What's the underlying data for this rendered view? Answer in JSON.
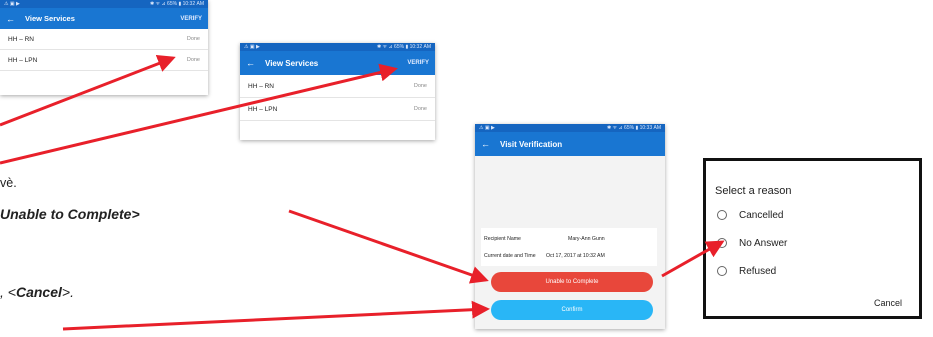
{
  "screen1": {
    "status_left": "⚠ ▣ ▶",
    "status_right": "✱ ᯤ ⊿ 65% ▮ 10:32 AM",
    "title": "View Services",
    "action": "VERIFY",
    "services": [
      {
        "name": "HH – RN",
        "status": "Done"
      },
      {
        "name": "HH – LPN",
        "status": "Done"
      }
    ]
  },
  "screen2": {
    "status_left": "⚠ ▣ ▶",
    "status_right": "✱ ᯤ ⊿ 65% ▮ 10:32 AM",
    "title": "View Services",
    "action": "VERIFY",
    "services": [
      {
        "name": "HH – RN",
        "status": "Done"
      },
      {
        "name": "HH – LPN",
        "status": "Done"
      }
    ]
  },
  "screen3": {
    "status_left": "⚠ ▣ ▶",
    "status_right": "✱ ᯤ ⊿ 65% ▮ 10:33 AM",
    "title": "Visit Verification",
    "recipient_label": "Recipient Name",
    "recipient_value": "Mary-Ann Gunn",
    "date_label": "Current date and Time",
    "date_value": "Oct 17, 2017 at 10:32 AM",
    "unable_button": "Unable to Complete",
    "confirm_button": "Confirm"
  },
  "dialog": {
    "title": "Select a reason",
    "options": [
      "Cancelled",
      "No Answer",
      "Refused"
    ],
    "cancel": "Cancel"
  },
  "doc": {
    "line1": "vè.",
    "line2": "Unable to Complete>",
    "line3": ", <",
    "line3_bold": "Cancel",
    "line3_end": ">."
  },
  "colors": {
    "appbar": "#1976d2",
    "statusbar": "#1565c0",
    "unable_button": "#e8473b",
    "confirm_button": "#29b6f6",
    "arrow": "#e8202a"
  }
}
